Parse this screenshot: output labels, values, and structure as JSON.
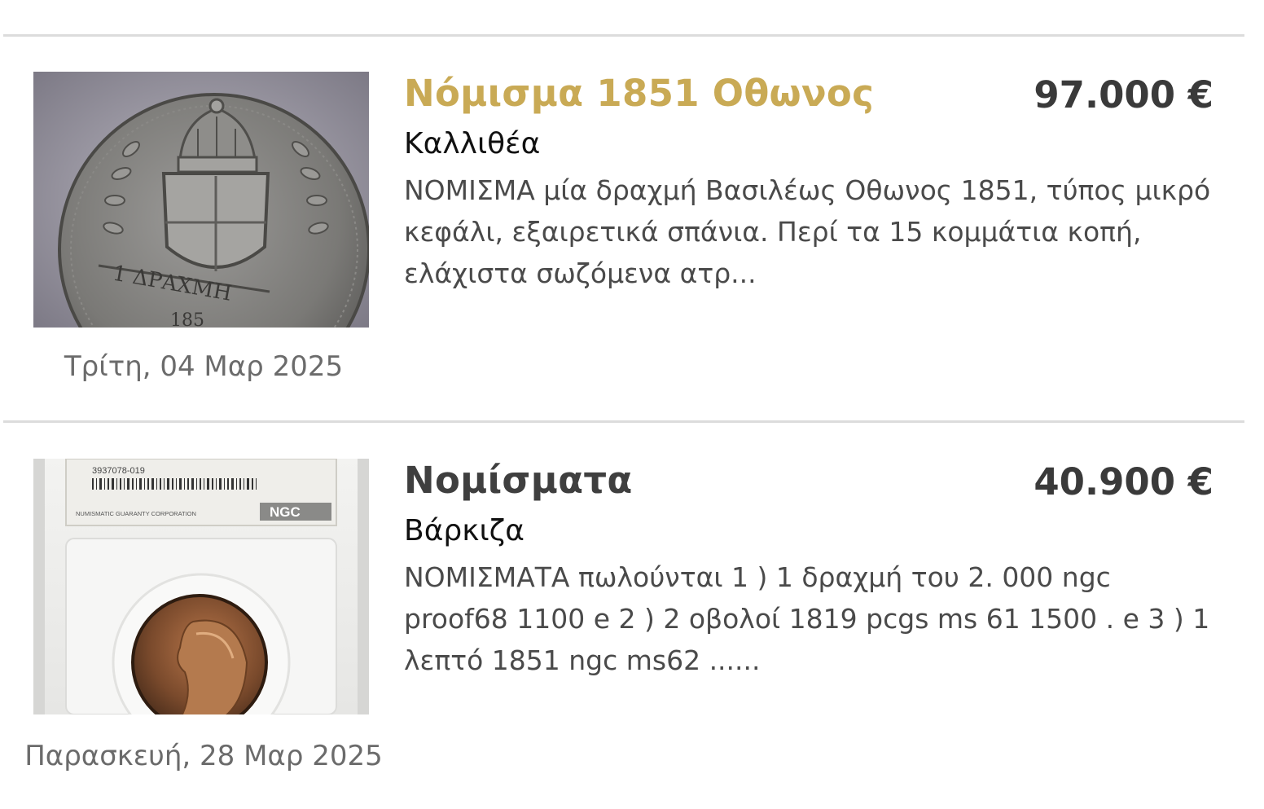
{
  "colors": {
    "featured_title": "#c9aa55",
    "regular_title": "#3f3f3f",
    "price": "#3a3a3a",
    "date": "#6b6b6b",
    "description": "#4a4a4a",
    "divider": "#dcdcdc"
  },
  "listings": [
    {
      "title": "Νόμισμα 1851 Οθωνος",
      "price": "97.000 €",
      "location": "Καλλιθέα",
      "description": "ΝΟΜΙΣΜΑ μία δραχμή Βασιλέως Οθωνος 1851, τύπος μικρό κεφάλι, εξαιρετικά σπάνια. Περί τα 15 κομμάτια κοπή, ελάχιστα σωζόμενα ατρ...",
      "date": "Τρίτη, 04 Μαρ 2025",
      "featured": true,
      "image": {
        "coin_inscription": "1 ΔΡΑΧΜΗ",
        "coin_year_partial": "185"
      }
    },
    {
      "title": "Νομίσματα",
      "price": "40.900 €",
      "location": "Βάρκιζα",
      "description": "ΝΟΜΙΣΜΑΤΑ πωλούνται 1 ) 1 δραχμή του 2. 000 ngc proof68 1100 e 2 ) 2 οβολοί 1819 pcgs ms 61 1500 . e 3 ) 1 λεπτό 1851 ngc ms62 ......",
      "date": "Παρασκευή, 28 Μαρ 2025",
      "featured": false,
      "image": {
        "cert_number": "3937078-019",
        "grader_name": "NUMISMATIC GUARANTY CORPORATION",
        "grader_logo": "NGC"
      }
    }
  ]
}
